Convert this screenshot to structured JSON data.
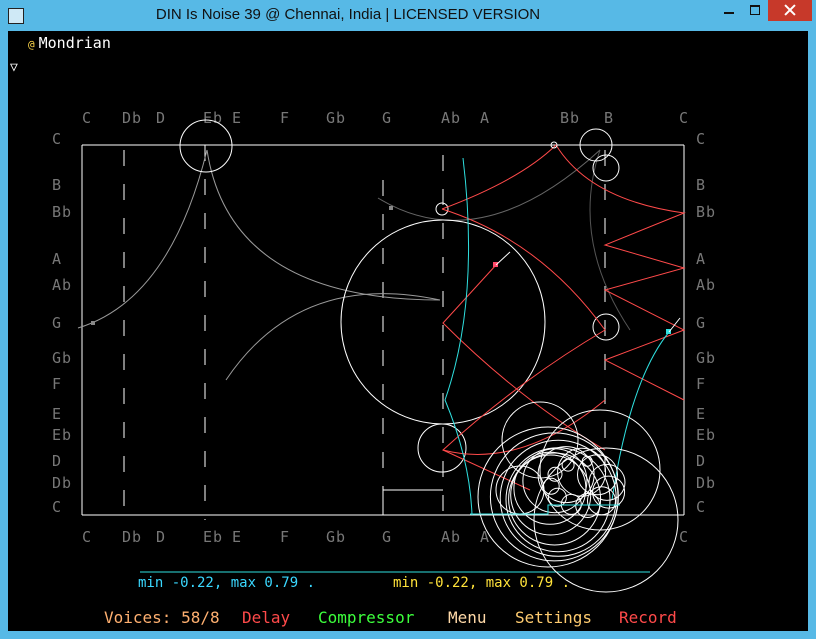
{
  "window": {
    "title": "DIN Is Noise 39 @ Chennai, India | LICENSED VERSION"
  },
  "instrument": {
    "name": "Mondrian",
    "marker": "@"
  },
  "dropdown_glyph": "▽",
  "notes_top": [
    "C",
    "Db",
    "D",
    "Eb",
    "E",
    "F",
    "Gb",
    "G",
    "Ab",
    "A",
    "Bb",
    "B",
    "C"
  ],
  "notes_bottom": [
    "C",
    "Db",
    "D",
    "Eb",
    "E",
    "F",
    "Gb",
    "G",
    "Ab",
    "A",
    "C"
  ],
  "notes_left": [
    "C",
    "B",
    "Bb",
    "A",
    "Ab",
    "G",
    "Gb",
    "F",
    "E",
    "Eb",
    "D",
    "Db",
    "C"
  ],
  "notes_right": [
    "C",
    "B",
    "Bb",
    "A",
    "Ab",
    "G",
    "Gb",
    "F",
    "E",
    "Eb",
    "D",
    "Db",
    "C"
  ],
  "stats": {
    "left": "min -0.22, max 0.79 .",
    "right": "min -0.22, max 0.79 ."
  },
  "menu": {
    "voices": "Voices: 58/8",
    "delay": "Delay",
    "compressor": "Compressor",
    "menu": "Menu",
    "settings": "Settings",
    "record": "Record"
  },
  "colors": {
    "frame": "#57b9e6",
    "close": "#c7392a",
    "red_curve": "#ff4a4a",
    "cyan": "#2fe0e0",
    "voices": "#ffb070",
    "delay": "#ff4a4a",
    "compressor": "#3cff3c",
    "menu": "#ffd9a8",
    "settings": "#ffcc70",
    "record": "#ff4a4a",
    "stats_left": "#3ad8ff",
    "stats_right": "#ffe23a"
  },
  "icons": {
    "minimize": "minimize-icon",
    "maximize": "maximize-icon",
    "close": "close-icon"
  }
}
